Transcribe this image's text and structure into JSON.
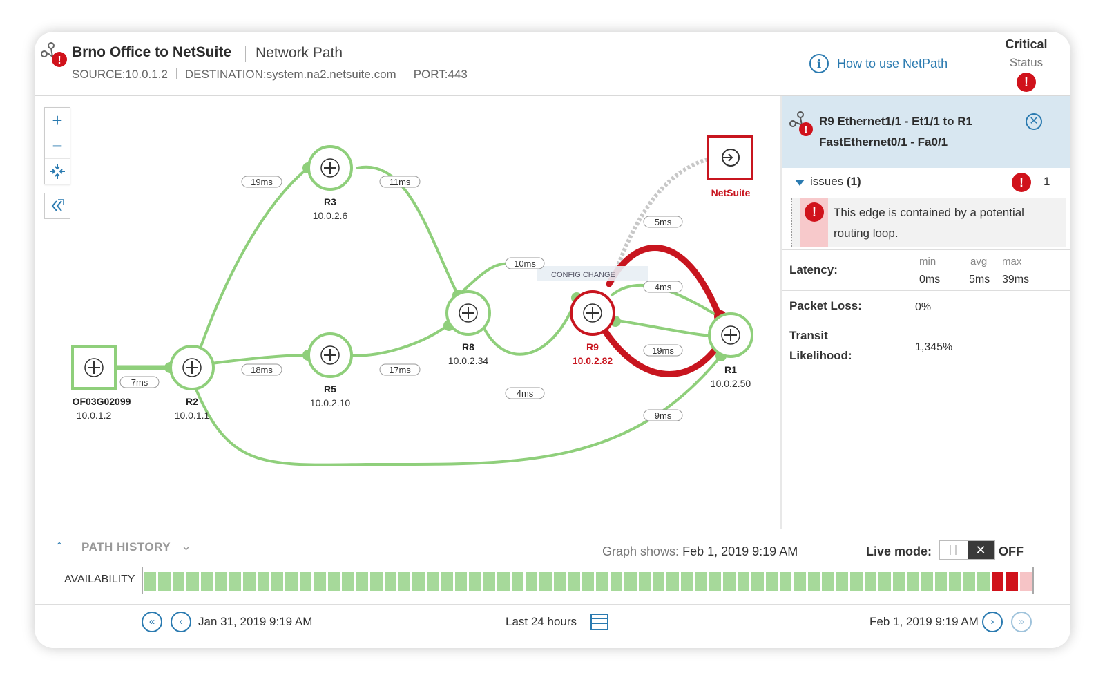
{
  "header": {
    "title": "Brno Office to NetSuite",
    "subtitle": "Network Path",
    "source": "SOURCE:10.0.1.2",
    "destination": "DESTINATION:system.na2.netsuite.com",
    "port": "PORT:443",
    "help_link": "How to use NetPath",
    "status_label": "Critical",
    "status_sub": "Status"
  },
  "graph": {
    "nodes": {
      "source": {
        "name": "OF03G02099",
        "ip": "10.0.1.2"
      },
      "r2": {
        "name": "R2",
        "ip": "10.0.1.1"
      },
      "r3": {
        "name": "R3",
        "ip": "10.0.2.6"
      },
      "r5": {
        "name": "R5",
        "ip": "10.0.2.10"
      },
      "r8": {
        "name": "R8",
        "ip": "10.0.2.34"
      },
      "r9": {
        "name": "R9",
        "ip": "10.0.2.82"
      },
      "r1": {
        "name": "R1",
        "ip": "10.0.2.50"
      },
      "dest": {
        "name": "NetSuite"
      }
    },
    "latencies": {
      "src_r2": "7ms",
      "r2_r3": "19ms",
      "r3_r8": "11ms",
      "r2_r5": "18ms",
      "r5_r8": "17ms",
      "r8_r9": "10ms",
      "r8_r9_low": "4ms",
      "r9_r1_a": "5ms",
      "r9_r1_b": "4ms",
      "r9_r1_c": "19ms",
      "r2_r1": "9ms"
    },
    "config_change": "CONFIG CHANGE",
    "colors": {
      "ok": "#8fcf7b",
      "critical": "#c8151f",
      "node_border": "#8fcf7b",
      "dest_border": "#c8151f"
    }
  },
  "panel": {
    "title": "R9 Ethernet1/1 - Et1/1 to R1 FastEthernet0/1 - Fa0/1",
    "issues_label": "issues",
    "issues_count_paren": "(1)",
    "issues_count": "1",
    "issue_text": "This edge is contained by a potential routing loop.",
    "latency": {
      "label": "Latency:",
      "min_h": "min",
      "avg_h": "avg",
      "max_h": "max",
      "min": "0ms",
      "avg": "5ms",
      "max": "39ms"
    },
    "packet_loss": {
      "label": "Packet Loss:",
      "value": "0%"
    },
    "transit": {
      "label1": "Transit",
      "label2": "Likelihood:",
      "value": "1,345%"
    }
  },
  "history": {
    "title": "PATH HISTORY",
    "graph_shows_label": "Graph shows:",
    "graph_shows_value": "Feb 1, 2019 9:19 AM",
    "live_mode_label": "Live mode:",
    "live_mode_state": "OFF",
    "availability_label": "AVAILABILITY",
    "availability": [
      "ok",
      "ok",
      "ok",
      "ok",
      "ok",
      "ok",
      "ok",
      "ok",
      "ok",
      "ok",
      "ok",
      "ok",
      "ok",
      "ok",
      "ok",
      "ok",
      "ok",
      "ok",
      "ok",
      "ok",
      "ok",
      "ok",
      "ok",
      "ok",
      "ok",
      "ok",
      "ok",
      "ok",
      "ok",
      "ok",
      "ok",
      "ok",
      "ok",
      "ok",
      "ok",
      "ok",
      "ok",
      "ok",
      "ok",
      "ok",
      "ok",
      "ok",
      "ok",
      "ok",
      "ok",
      "ok",
      "ok",
      "ok",
      "ok",
      "ok",
      "ok",
      "ok",
      "ok",
      "ok",
      "ok",
      "ok",
      "ok",
      "ok",
      "ok",
      "ok",
      "critical",
      "critical",
      "partial"
    ],
    "colors": {
      "ok": "#a6d99a",
      "critical": "#d0121b",
      "partial": "#f6c4c6"
    },
    "start": "Jan 31, 2019 9:19 AM",
    "range": "Last 24 hours",
    "end": "Feb 1, 2019 9:19 AM"
  }
}
